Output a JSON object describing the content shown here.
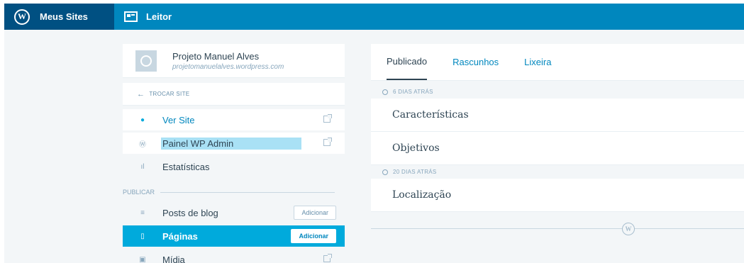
{
  "masterbar": {
    "my_sites": "Meus Sites",
    "reader": "Leitor"
  },
  "site": {
    "name": "Projeto Manuel Alves",
    "url": "projetomanuelalves.wordpress.com",
    "switch": "TROCAR SITE"
  },
  "sidebar": {
    "view_site": "Ver Site",
    "wp_admin": "Painel WP Admin",
    "stats": "Estatísticas",
    "section_publish": "PUBLICAR",
    "posts": "Posts de blog",
    "posts_add": "Adicionar",
    "pages": "Páginas",
    "pages_add": "Adicionar",
    "media": "Mídia"
  },
  "tabs": {
    "published": "Publicado",
    "drafts": "Rascunhos",
    "trash": "Lixeira"
  },
  "groups": [
    {
      "label": "6 DIAS ATRÁS",
      "pages": [
        "Características",
        "Objetivos"
      ]
    },
    {
      "label": "20 DIAS ATRÁS",
      "pages": [
        "Localização"
      ]
    }
  ],
  "colors": {
    "masterbar": "#0087be",
    "masterbar_active": "#005082",
    "selected": "#00aadc",
    "highlight": "#a9e1f5"
  }
}
